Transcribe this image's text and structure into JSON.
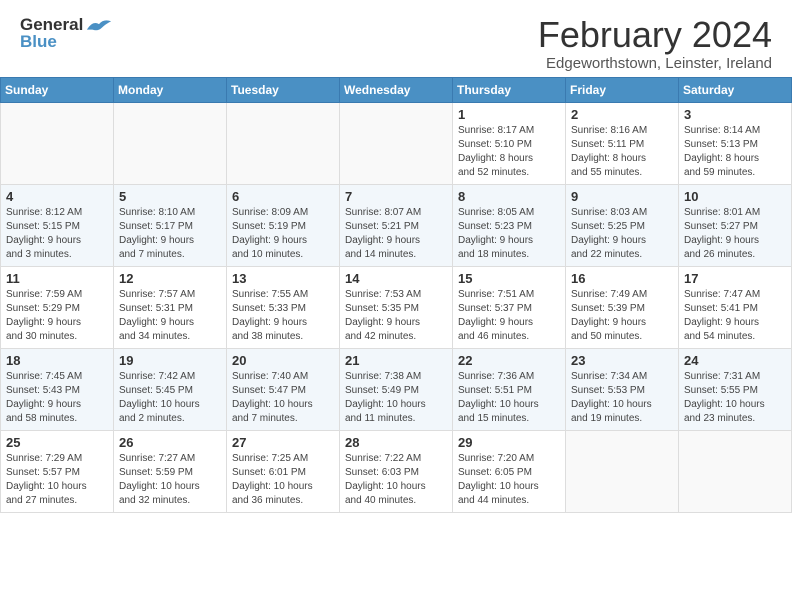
{
  "header": {
    "logo_general": "General",
    "logo_blue": "Blue",
    "month_title": "February 2024",
    "location": "Edgeworthstown, Leinster, Ireland"
  },
  "days_of_week": [
    "Sunday",
    "Monday",
    "Tuesday",
    "Wednesday",
    "Thursday",
    "Friday",
    "Saturday"
  ],
  "weeks": [
    [
      {
        "day": "",
        "info": ""
      },
      {
        "day": "",
        "info": ""
      },
      {
        "day": "",
        "info": ""
      },
      {
        "day": "",
        "info": ""
      },
      {
        "day": "1",
        "info": "Sunrise: 8:17 AM\nSunset: 5:10 PM\nDaylight: 8 hours\nand 52 minutes."
      },
      {
        "day": "2",
        "info": "Sunrise: 8:16 AM\nSunset: 5:11 PM\nDaylight: 8 hours\nand 55 minutes."
      },
      {
        "day": "3",
        "info": "Sunrise: 8:14 AM\nSunset: 5:13 PM\nDaylight: 8 hours\nand 59 minutes."
      }
    ],
    [
      {
        "day": "4",
        "info": "Sunrise: 8:12 AM\nSunset: 5:15 PM\nDaylight: 9 hours\nand 3 minutes."
      },
      {
        "day": "5",
        "info": "Sunrise: 8:10 AM\nSunset: 5:17 PM\nDaylight: 9 hours\nand 7 minutes."
      },
      {
        "day": "6",
        "info": "Sunrise: 8:09 AM\nSunset: 5:19 PM\nDaylight: 9 hours\nand 10 minutes."
      },
      {
        "day": "7",
        "info": "Sunrise: 8:07 AM\nSunset: 5:21 PM\nDaylight: 9 hours\nand 14 minutes."
      },
      {
        "day": "8",
        "info": "Sunrise: 8:05 AM\nSunset: 5:23 PM\nDaylight: 9 hours\nand 18 minutes."
      },
      {
        "day": "9",
        "info": "Sunrise: 8:03 AM\nSunset: 5:25 PM\nDaylight: 9 hours\nand 22 minutes."
      },
      {
        "day": "10",
        "info": "Sunrise: 8:01 AM\nSunset: 5:27 PM\nDaylight: 9 hours\nand 26 minutes."
      }
    ],
    [
      {
        "day": "11",
        "info": "Sunrise: 7:59 AM\nSunset: 5:29 PM\nDaylight: 9 hours\nand 30 minutes."
      },
      {
        "day": "12",
        "info": "Sunrise: 7:57 AM\nSunset: 5:31 PM\nDaylight: 9 hours\nand 34 minutes."
      },
      {
        "day": "13",
        "info": "Sunrise: 7:55 AM\nSunset: 5:33 PM\nDaylight: 9 hours\nand 38 minutes."
      },
      {
        "day": "14",
        "info": "Sunrise: 7:53 AM\nSunset: 5:35 PM\nDaylight: 9 hours\nand 42 minutes."
      },
      {
        "day": "15",
        "info": "Sunrise: 7:51 AM\nSunset: 5:37 PM\nDaylight: 9 hours\nand 46 minutes."
      },
      {
        "day": "16",
        "info": "Sunrise: 7:49 AM\nSunset: 5:39 PM\nDaylight: 9 hours\nand 50 minutes."
      },
      {
        "day": "17",
        "info": "Sunrise: 7:47 AM\nSunset: 5:41 PM\nDaylight: 9 hours\nand 54 minutes."
      }
    ],
    [
      {
        "day": "18",
        "info": "Sunrise: 7:45 AM\nSunset: 5:43 PM\nDaylight: 9 hours\nand 58 minutes."
      },
      {
        "day": "19",
        "info": "Sunrise: 7:42 AM\nSunset: 5:45 PM\nDaylight: 10 hours\nand 2 minutes."
      },
      {
        "day": "20",
        "info": "Sunrise: 7:40 AM\nSunset: 5:47 PM\nDaylight: 10 hours\nand 7 minutes."
      },
      {
        "day": "21",
        "info": "Sunrise: 7:38 AM\nSunset: 5:49 PM\nDaylight: 10 hours\nand 11 minutes."
      },
      {
        "day": "22",
        "info": "Sunrise: 7:36 AM\nSunset: 5:51 PM\nDaylight: 10 hours\nand 15 minutes."
      },
      {
        "day": "23",
        "info": "Sunrise: 7:34 AM\nSunset: 5:53 PM\nDaylight: 10 hours\nand 19 minutes."
      },
      {
        "day": "24",
        "info": "Sunrise: 7:31 AM\nSunset: 5:55 PM\nDaylight: 10 hours\nand 23 minutes."
      }
    ],
    [
      {
        "day": "25",
        "info": "Sunrise: 7:29 AM\nSunset: 5:57 PM\nDaylight: 10 hours\nand 27 minutes."
      },
      {
        "day": "26",
        "info": "Sunrise: 7:27 AM\nSunset: 5:59 PM\nDaylight: 10 hours\nand 32 minutes."
      },
      {
        "day": "27",
        "info": "Sunrise: 7:25 AM\nSunset: 6:01 PM\nDaylight: 10 hours\nand 36 minutes."
      },
      {
        "day": "28",
        "info": "Sunrise: 7:22 AM\nSunset: 6:03 PM\nDaylight: 10 hours\nand 40 minutes."
      },
      {
        "day": "29",
        "info": "Sunrise: 7:20 AM\nSunset: 6:05 PM\nDaylight: 10 hours\nand 44 minutes."
      },
      {
        "day": "",
        "info": ""
      },
      {
        "day": "",
        "info": ""
      }
    ]
  ]
}
